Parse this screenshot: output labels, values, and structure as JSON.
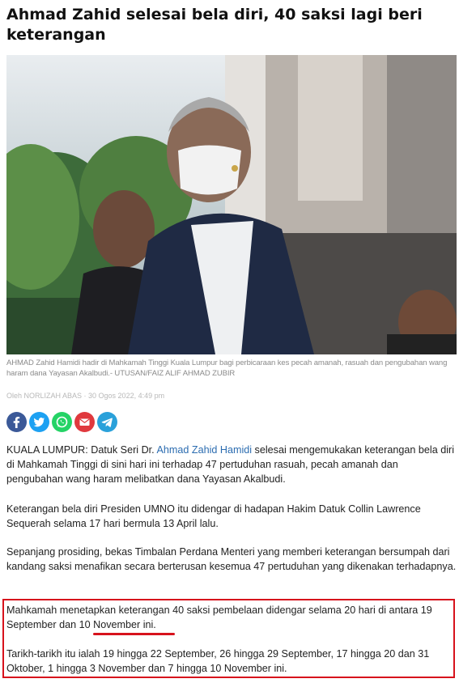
{
  "article": {
    "title": "Ahmad Zahid selesai bela diri, 40 saksi lagi beri keterangan",
    "caption": "AHMAD Zahid Hamidi hadir di Mahkamah Tinggi Kuala Lumpur bagi perbicaraan kes pecah amanah, rasuah dan pengubahan wang haram dana Yayasan Akalbudi.- UTUSAN/FAIZ ALIF AHMAD ZUBIR",
    "byline": "Oleh NORLIZAH ABAS · 30 Ogos 2022, 4:49 pm",
    "share": [
      {
        "icon": "facebook-icon",
        "color": "#3b5998"
      },
      {
        "icon": "twitter-icon",
        "color": "#1da1f2"
      },
      {
        "icon": "whatsapp-icon",
        "color": "#25d366"
      },
      {
        "icon": "email-icon",
        "color": "#e0393e"
      },
      {
        "icon": "telegram-icon",
        "color": "#2aa1da"
      }
    ],
    "p1": {
      "before": "KUALA LUMPUR: Datuk Seri Dr. ",
      "link": "Ahmad Zahid Hamidi",
      "after": " selesai mengemukakan keterangan bela diri di Mahkamah Tinggi di sini hari ini terhadap 47 pertuduhan rasuah, pecah amanah dan pengubahan wang haram melibatkan dana Yayasan Akalbudi."
    },
    "p2": "Keterangan bela diri Presiden UMNO itu didengar di hadapan Hakim Datuk Collin Lawrence Sequerah selama 17 hari bermula 13 April lalu.",
    "p3": "Sepanjang prosiding, bekas Timbalan Perdana Menteri yang memberi keterangan bersumpah dari kandang saksi menafikan secara berterusan kesemua 47 pertuduhan yang dikenakan terhadapnya.",
    "p4": "Mahkamah menetapkan keterangan 40 saksi pembelaan didengar selama 20 hari di antara 19 September dan 10 November ini.",
    "p5": "Tarikh-tarikh itu ialah 19 hingga 22 September, 26 hingga 29 September, 17 hingga 20 dan 31 Oktober, 1 hingga 3 November dan 7 hingga 10 November ini."
  },
  "colors": {
    "highlight": "#d7121c",
    "link": "#2b6cb0"
  }
}
